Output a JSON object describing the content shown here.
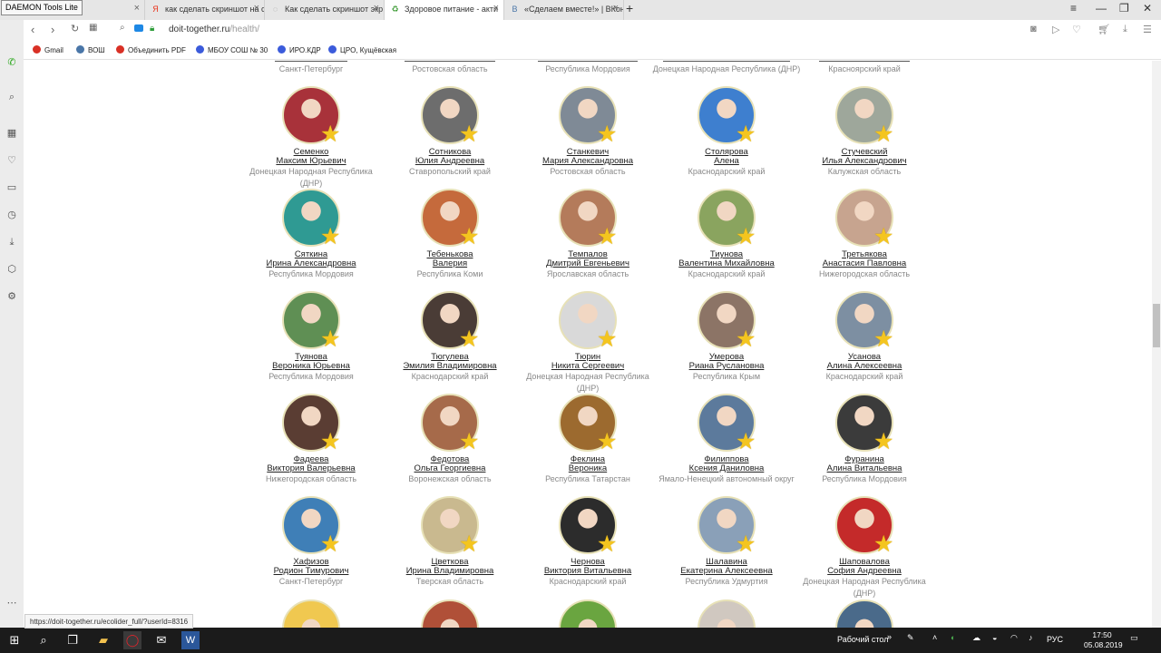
{
  "tooltip": "DAEMON Tools Lite",
  "tabs": [
    {
      "label": "е сведения - Гос",
      "fav": "Г",
      "color": "#c0392b"
    },
    {
      "label": "как сделать скриншот на с",
      "fav": "Я",
      "color": "#e8341c"
    },
    {
      "label": "Как сделать скриншот экр",
      "fav": "◌",
      "color": "#888888"
    },
    {
      "label": "Здоровое питание - акти",
      "fav": "♻",
      "color": "#3d9b35"
    },
    {
      "label": "«Сделаем вместе!» | ВКон",
      "fav": "В",
      "color": "#4a76a8"
    }
  ],
  "window": {
    "minimize": "—",
    "maximize": "❐",
    "close": "✕",
    "menu": "≡"
  },
  "address": {
    "host": "doit-together.ru",
    "path": "/health/"
  },
  "bookmarks": [
    "Gmail",
    "ВОШ",
    "Объединить PDF",
    "МБОУ СОШ № 30",
    "ИРО.КДР",
    "ЦРО, Кущёвская"
  ],
  "top_regions": [
    "Санкт-Петербург",
    "Ростовская область",
    "Республика Мордовия",
    "Донецкая Народная Республика (ДНР)",
    "Красноярский край"
  ],
  "rows": [
    [
      {
        "surname": "Семенко",
        "given": "Максим Юрьевич",
        "region": "Донецкая Народная Республика (ДНР)",
        "bg": "#a8323a"
      },
      {
        "surname": "Сотникова",
        "given": "Юлия Андреевна",
        "region": "Ставропольский край",
        "bg": "#6d6d6d"
      },
      {
        "surname": "Станкевич",
        "given": "Мария Александровна",
        "region": "Ростовская область",
        "bg": "#7f8a96"
      },
      {
        "surname": "Столярова",
        "given": "Алена",
        "region": "Краснодарский край",
        "bg": "#3e7fcf"
      },
      {
        "surname": "Стучевский",
        "given": "Илья Александрович",
        "region": "Калужская область",
        "bg": "#9ea79b"
      }
    ],
    [
      {
        "surname": "Сяткина",
        "given": "Ирина Александровна",
        "region": "Республика Мордовия",
        "bg": "#2f9a93"
      },
      {
        "surname": "Тебенькова",
        "given": "Валерия",
        "region": "Республика Коми",
        "bg": "#c56a3c"
      },
      {
        "surname": "Темпалов",
        "given": "Дмитрий Евгеньевич",
        "region": "Ярославская область",
        "bg": "#b47b5b"
      },
      {
        "surname": "Тиунова",
        "given": "Валентина Михайловна",
        "region": "Краснодарский край",
        "bg": "#8aa45f"
      },
      {
        "surname": "Третьякова",
        "given": "Анастасия Павловна",
        "region": "Нижегородская область",
        "bg": "#c7a48f"
      }
    ],
    [
      {
        "surname": "Туянова",
        "given": "Вероника Юрьевна",
        "region": "Республика Мордовия",
        "bg": "#5f8f54"
      },
      {
        "surname": "Тюгулева",
        "given": "Эмилия Владимировна",
        "region": "Краснодарский край",
        "bg": "#4a3c36"
      },
      {
        "surname": "Тюрин",
        "given": "Никита Сергеевич",
        "region": "Донецкая Народная Республика (ДНР)",
        "bg": "#d9d9d9"
      },
      {
        "surname": "Умерова",
        "given": "Риана Руслановна",
        "region": "Республика Крым",
        "bg": "#8c7466"
      },
      {
        "surname": "Усанова",
        "given": "Алина Алексеевна",
        "region": "Краснодарский край",
        "bg": "#7d8fa2"
      }
    ],
    [
      {
        "surname": "Фадеева",
        "given": "Виктория Валерьевна",
        "region": "Нижегородская область",
        "bg": "#5a3d33"
      },
      {
        "surname": "Федотова",
        "given": "Ольга Георгиевна",
        "region": "Воронежская область",
        "bg": "#a66a4a"
      },
      {
        "surname": "Феклина",
        "given": "Вероника",
        "region": "Республика Татарстан",
        "bg": "#9c6a2f"
      },
      {
        "surname": "Филиппова",
        "given": "Ксения Даниловна",
        "region": "Ямало-Ненецкий автономный округ",
        "bg": "#5c7a9c"
      },
      {
        "surname": "Фуранина",
        "given": "Алина Витальевна",
        "region": "Республика Мордовия",
        "bg": "#3b3b3b"
      }
    ],
    [
      {
        "surname": "Хафизов",
        "given": "Родион Тимурович",
        "region": "Санкт-Петербург",
        "bg": "#3f7fb7"
      },
      {
        "surname": "Цветкова",
        "given": "Ирина Владимировна",
        "region": "Тверская область",
        "bg": "#c9b98f"
      },
      {
        "surname": "Чернова",
        "given": "Виктория Витальевна",
        "region": "Краснодарский край",
        "bg": "#2c2c2c"
      },
      {
        "surname": "Шалавина",
        "given": "Екатерина Алексеевна",
        "region": "Республика Удмуртия",
        "bg": "#8aa0b8"
      },
      {
        "surname": "Шаповалова",
        "given": "София Андреевна",
        "region": "Донецкая Народная Республика (ДНР)",
        "bg": "#c42a2a"
      }
    ]
  ],
  "partial_row_colors": [
    "#f0c850",
    "#b05038",
    "#6aa540",
    "#d0c8c0",
    "#4a6a8a"
  ],
  "status_url": "https://doit-together.ru/ecolider_full/?userId=8316",
  "taskbar": {
    "desktop": "Рабочий стол",
    "lang": "РУС",
    "time": "17:50",
    "date": "05.08.2019"
  }
}
